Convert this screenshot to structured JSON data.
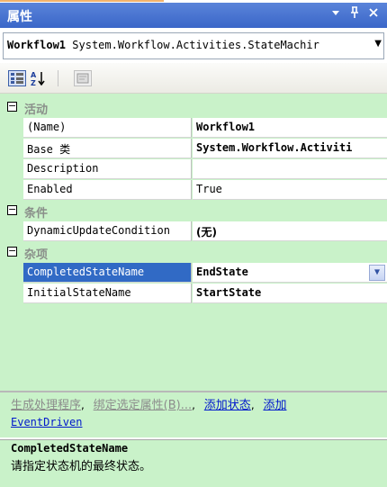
{
  "window": {
    "title": "属性"
  },
  "object_selector": {
    "name": "Workflow1",
    "type": "System.Workflow.Activities.StateMachir"
  },
  "grid": {
    "categories": [
      {
        "label": "活动",
        "expanded": true,
        "properties": [
          {
            "name": "(Name)",
            "value": "Workflow1"
          },
          {
            "name": "Base 类",
            "value": "System.Workflow.Activiti"
          },
          {
            "name": "Description",
            "value": ""
          },
          {
            "name": "Enabled",
            "value": "True"
          }
        ]
      },
      {
        "label": "条件",
        "expanded": true,
        "properties": [
          {
            "name": "DynamicUpdateCondition",
            "value": "(无)"
          }
        ]
      },
      {
        "label": "杂项",
        "expanded": true,
        "properties": [
          {
            "name": "CompletedStateName",
            "value": "EndState",
            "selected": true
          },
          {
            "name": "InitialStateName",
            "value": "StartState"
          }
        ]
      }
    ]
  },
  "commands": {
    "generate_handlers": "生成处理程序",
    "bind_selected": "绑定选定属性(B)...",
    "add_state": "添加状态",
    "add_eventdriven_1": "添加",
    "add_eventdriven_2": "EventDriven",
    "separator": ","
  },
  "description": {
    "title": "CompletedStateName",
    "text": "请指定状态机的最终状态。"
  },
  "colors": {
    "background": "#c9f2c9",
    "title_bar": "#3a66c8",
    "selection": "#316ac5",
    "link": "#0018cc"
  }
}
